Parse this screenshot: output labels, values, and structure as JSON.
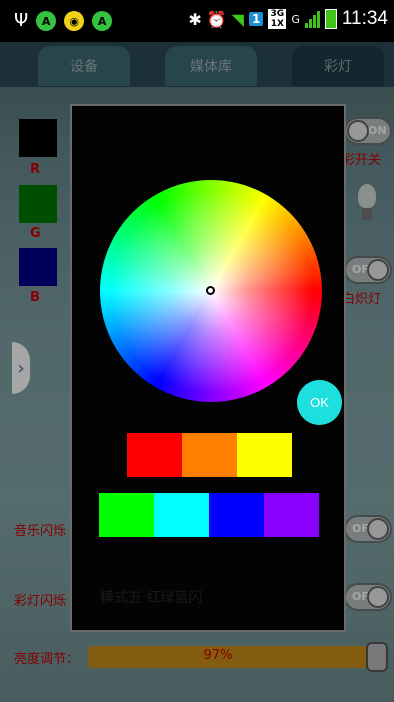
{
  "status_bar": {
    "left_icons": [
      "usb-icon",
      "android-notification-icon",
      "chrome-notification-icon",
      "android-notification-icon"
    ],
    "right": {
      "bluetooth": "✱",
      "alarm": "⏰",
      "sim_slot": "1",
      "network_type": "3G 1X",
      "carrier_letter": "G",
      "time": "11:34"
    }
  },
  "tabs": [
    {
      "label": "设备",
      "active": false
    },
    {
      "label": "媒体库",
      "active": false
    },
    {
      "label": "彩灯",
      "active": true
    }
  ],
  "background": {
    "swatches": [
      {
        "label": "R",
        "color": "#000000"
      },
      {
        "label": "G",
        "color": "#007a00"
      },
      {
        "label": "B",
        "color": "#00008a"
      }
    ],
    "toggles": [
      {
        "label": "ON"
      },
      {
        "label": "OFF"
      },
      {
        "label": "OFF"
      },
      {
        "label": "OFF"
      }
    ],
    "right_labels": [
      "彩开关",
      "白炽灯"
    ],
    "left_labels": [
      "音乐闪烁",
      "彩灯闪烁"
    ],
    "brightness_label": "亮度调节：",
    "brightness_value": "97%",
    "brightness_level": 0.97
  },
  "dialog": {
    "ok_label": "OK",
    "faded_text": "模式五 红绿蓝闪",
    "preset_rows": [
      [
        "#ff0000",
        "#ff8000",
        "#ffff00"
      ],
      [
        "#00ff00",
        "#00ffff",
        "#0000ff",
        "#8800ff"
      ]
    ]
  }
}
